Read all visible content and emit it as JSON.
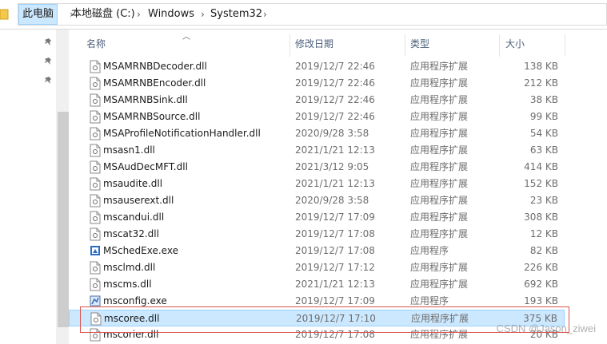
{
  "breadcrumb": {
    "items": [
      "此电脑",
      "本地磁盘 (C:)",
      "Windows",
      "System32"
    ],
    "separator": "›"
  },
  "columns": {
    "name": "名称",
    "date": "修改日期",
    "type": "类型",
    "size": "大小"
  },
  "files": [
    {
      "name": "MSAMRNBDecoder.dll",
      "date": "2019/12/7 22:46",
      "type": "应用程序扩展",
      "size": "138 KB",
      "icon": "dll-file-icon"
    },
    {
      "name": "MSAMRNBEncoder.dll",
      "date": "2019/12/7 22:46",
      "type": "应用程序扩展",
      "size": "212 KB",
      "icon": "dll-file-icon"
    },
    {
      "name": "MSAMRNBSink.dll",
      "date": "2019/12/7 22:46",
      "type": "应用程序扩展",
      "size": "38 KB",
      "icon": "dll-file-icon"
    },
    {
      "name": "MSAMRNBSource.dll",
      "date": "2019/12/7 22:46",
      "type": "应用程序扩展",
      "size": "99 KB",
      "icon": "dll-file-icon"
    },
    {
      "name": "MSAProfileNotificationHandler.dll",
      "date": "2020/9/28 3:58",
      "type": "应用程序扩展",
      "size": "54 KB",
      "icon": "dll-file-icon"
    },
    {
      "name": "msasn1.dll",
      "date": "2021/1/21 12:13",
      "type": "应用程序扩展",
      "size": "63 KB",
      "icon": "dll-file-icon"
    },
    {
      "name": "MSAudDecMFT.dll",
      "date": "2021/3/12 9:05",
      "type": "应用程序扩展",
      "size": "414 KB",
      "icon": "dll-file-icon"
    },
    {
      "name": "msaudite.dll",
      "date": "2021/1/21 12:13",
      "type": "应用程序扩展",
      "size": "152 KB",
      "icon": "dll-file-icon"
    },
    {
      "name": "msauserext.dll",
      "date": "2020/9/28 3:58",
      "type": "应用程序扩展",
      "size": "23 KB",
      "icon": "dll-file-icon"
    },
    {
      "name": "mscandui.dll",
      "date": "2019/12/7 17:09",
      "type": "应用程序扩展",
      "size": "308 KB",
      "icon": "dll-file-icon"
    },
    {
      "name": "mscat32.dll",
      "date": "2019/12/7 17:08",
      "type": "应用程序扩展",
      "size": "12 KB",
      "icon": "dll-file-icon"
    },
    {
      "name": "MSchedExe.exe",
      "date": "2019/12/7 17:08",
      "type": "应用程序",
      "size": "82 KB",
      "icon": "exe-app-icon"
    },
    {
      "name": "msclmd.dll",
      "date": "2019/12/7 17:12",
      "type": "应用程序扩展",
      "size": "226 KB",
      "icon": "dll-file-icon"
    },
    {
      "name": "mscms.dll",
      "date": "2021/1/21 12:13",
      "type": "应用程序扩展",
      "size": "692 KB",
      "icon": "dll-file-icon"
    },
    {
      "name": "msconfig.exe",
      "date": "2019/12/7 17:09",
      "type": "应用程序",
      "size": "193 KB",
      "icon": "config-app-icon"
    },
    {
      "name": "mscoree.dll",
      "date": "2019/12/7 17:10",
      "type": "应用程序扩展",
      "size": "375 KB",
      "icon": "dll-file-icon",
      "selected": true
    },
    {
      "name": "mscorier.dll",
      "date": "2019/12/7 17:08",
      "type": "应用程序扩展",
      "size": "20 KB",
      "icon": "dll-file-icon"
    }
  ],
  "watermark": "CSDN @Jason_ziwei"
}
